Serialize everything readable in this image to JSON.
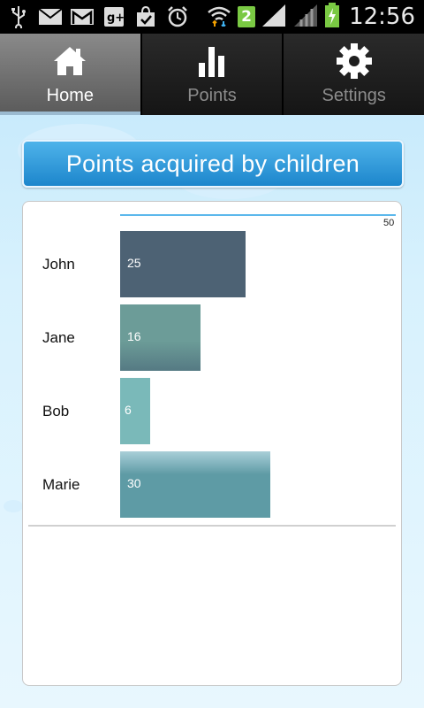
{
  "status_bar": {
    "time": "12:56",
    "badge": "2",
    "icons": [
      "usb-icon",
      "mail-icon",
      "gmail-icon",
      "google-plus-icon",
      "shopping-bag-icon",
      "alarm-icon",
      "wifi-icon",
      "sim-badge-icon",
      "signal-icon",
      "signal-empty-icon",
      "battery-charging-icon"
    ]
  },
  "tabs": [
    {
      "label": "Home",
      "icon": "home-icon",
      "active": true
    },
    {
      "label": "Points",
      "icon": "bar-chart-icon",
      "active": false
    },
    {
      "label": "Settings",
      "icon": "gear-icon",
      "active": false
    }
  ],
  "banner": {
    "title": "Points acquired by children"
  },
  "chart_data": {
    "type": "bar",
    "orientation": "horizontal",
    "categories": [
      "John",
      "Jane",
      "Bob",
      "Marie"
    ],
    "values": [
      25,
      16,
      6,
      30
    ],
    "xlim": [
      0,
      50
    ],
    "max_label": "50",
    "title": "",
    "xlabel": "",
    "ylabel": "",
    "colors": [
      "#4d6274",
      "#62918d",
      "#7ab9b9",
      "#5e9ba5"
    ],
    "accent": "#5cb8ec"
  }
}
